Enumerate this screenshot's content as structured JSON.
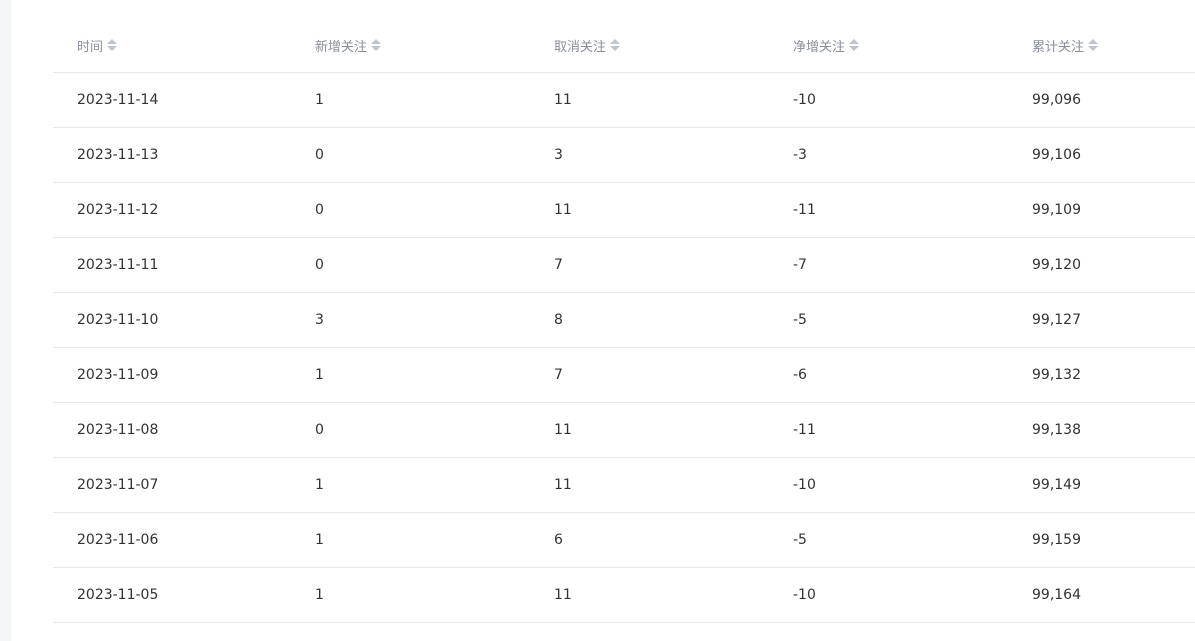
{
  "table": {
    "columns": [
      {
        "label": "时间",
        "sort_icon": "sort-icon"
      },
      {
        "label": "新增关注",
        "sort_icon": "sort-icon"
      },
      {
        "label": "取消关注",
        "sort_icon": "sort-icon"
      },
      {
        "label": "净增关注",
        "sort_icon": "sort-icon"
      },
      {
        "label": "累计关注",
        "sort_icon": "sort-icon"
      }
    ],
    "rows": [
      [
        "2023-11-14",
        "1",
        "11",
        "-10",
        "99,096"
      ],
      [
        "2023-11-13",
        "0",
        "3",
        "-3",
        "99,106"
      ],
      [
        "2023-11-12",
        "0",
        "11",
        "-11",
        "99,109"
      ],
      [
        "2023-11-11",
        "0",
        "7",
        "-7",
        "99,120"
      ],
      [
        "2023-11-10",
        "3",
        "8",
        "-5",
        "99,127"
      ],
      [
        "2023-11-09",
        "1",
        "7",
        "-6",
        "99,132"
      ],
      [
        "2023-11-08",
        "0",
        "11",
        "-11",
        "99,138"
      ],
      [
        "2023-11-07",
        "1",
        "11",
        "-10",
        "99,149"
      ],
      [
        "2023-11-06",
        "1",
        "6",
        "-5",
        "99,159"
      ],
      [
        "2023-11-05",
        "1",
        "11",
        "-10",
        "99,164"
      ]
    ]
  },
  "colors": {
    "header_text": "#8a8f99",
    "cell_text": "#333333",
    "divider": "#e6e8eb",
    "sort_icon": "#c0c4cc",
    "side_background": "#f4f5f7"
  }
}
